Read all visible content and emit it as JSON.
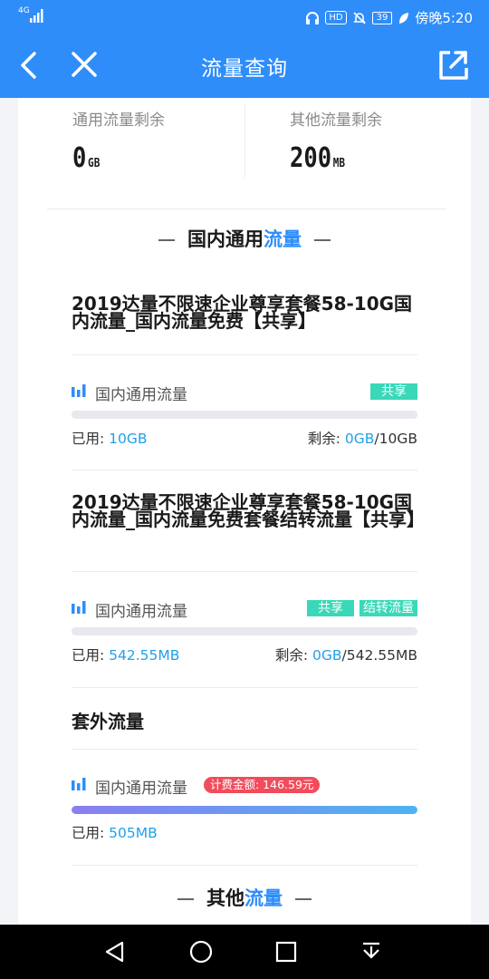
{
  "status_bar": {
    "network": "4G",
    "time": "傍晚5:20",
    "battery": "39",
    "hd": "HD"
  },
  "nav": {
    "title": "流量查询"
  },
  "summary": {
    "general": {
      "label": "通用流量剩余",
      "value": "0",
      "unit": "GB"
    },
    "other": {
      "label": "其他流量剩余",
      "value": "200",
      "unit": "MB"
    }
  },
  "sections": {
    "domestic": {
      "prefix": "国内通用",
      "highlight": "流量"
    },
    "other": {
      "prefix": "其他",
      "highlight": "流量"
    }
  },
  "packages": [
    {
      "title": "2019达量不限速企业尊享套餐58-10G国内流量_国内流量免费【共享】",
      "usage_label": "国内通用流量",
      "tags": [
        "共享"
      ],
      "used_label": "已用: ",
      "used": "10GB",
      "remain_label": "剩余: ",
      "remain": "0GB",
      "total": "/10GB",
      "used_fraction": 1.0
    },
    {
      "title": "2019达量不限速企业尊享套餐58-10G国内流量_国内流量免费套餐结转流量【共享】",
      "usage_label": "国内通用流量",
      "tags": [
        "共享",
        "结转流量"
      ],
      "used_label": "已用: ",
      "used": "542.55MB",
      "remain_label": "剩余: ",
      "remain": "0GB",
      "total": "/542.55MB",
      "used_fraction": 1.0
    }
  ],
  "extra": {
    "title": "套外流量",
    "usage_label": "国内通用流量",
    "fee": "计费金额: 146.59元",
    "used_label": "已用: ",
    "used": "505MB",
    "used_fraction": 1.0
  },
  "colors": {
    "accent": "#2f8dfa",
    "tag": "#3ad8b8",
    "fee": "#f24c5c",
    "number": "#21a0e8"
  }
}
